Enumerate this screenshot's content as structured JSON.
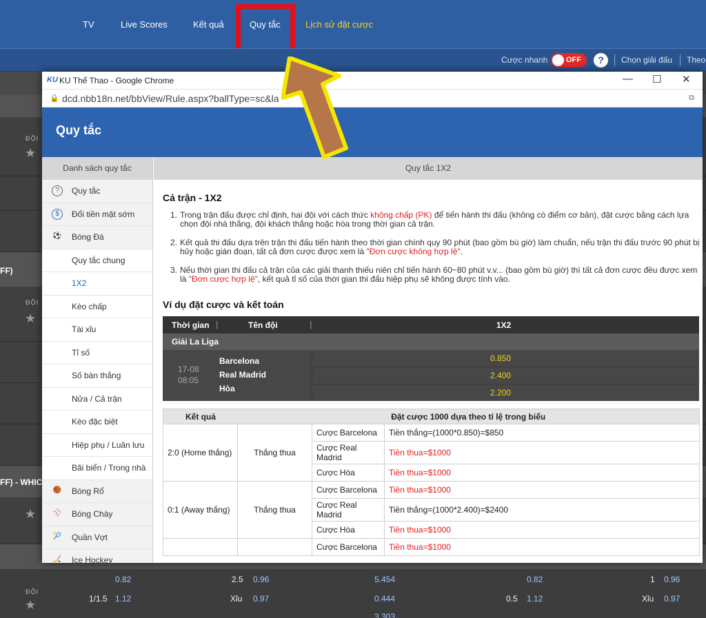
{
  "nav": {
    "tv": "TV",
    "live": "Live Scores",
    "result": "Kết quả",
    "rules": "Quy tắc",
    "history": "Lịch sử đặt cược"
  },
  "subbar": {
    "quick_bet": "Cược nhanh",
    "toggle": "OFF",
    "help": "?",
    "choose_league": "Chọn giải đấu",
    "sort": "Theo"
  },
  "background": {
    "code": "ĐỘI",
    "side_tag_1": "FF)",
    "side_tag_2": "FF) - WHICH"
  },
  "bottom_odds": {
    "r1": [
      "0.82",
      "2.5",
      "0.96",
      "5.454",
      "0.82",
      "1",
      "0.96"
    ],
    "r2": [
      "1/1.5",
      "1.12",
      "Xỉu",
      "0.97",
      "0.444",
      "0.5",
      "1.12",
      "Xỉu",
      "0.97"
    ],
    "r3": "3.303"
  },
  "window": {
    "favicon": "KU",
    "title": "KU Thể Thao - Google Chrome",
    "minimize": "—",
    "maximize": "☐",
    "close": "✕",
    "url": "dcd.nbb18n.net/bbView/Rule.aspx?ballType=sc&la"
  },
  "rules": {
    "heading": "Quy tắc",
    "list_title": "Danh sách quy tắc",
    "content_title": "Quy tắc 1X2",
    "nav": [
      {
        "label": "Quy tắc",
        "icon": "?"
      },
      {
        "label": "Đổi tiền mặt sớm",
        "icon": "$"
      },
      {
        "label": "Bóng Đá",
        "icon": "⚽"
      },
      {
        "label": "Quy tắc chung"
      },
      {
        "label": "1X2"
      },
      {
        "label": "Kèo chấp"
      },
      {
        "label": "Tài xỉu"
      },
      {
        "label": "Tỉ số"
      },
      {
        "label": "Số bàn thắng"
      },
      {
        "label": "Nửa / Cả trận"
      },
      {
        "label": "Kèo đặc biệt"
      },
      {
        "label": "Hiệp phụ / Luân lưu"
      },
      {
        "label": "Bãi biển / Trong nhà"
      },
      {
        "label": "Bóng Rổ",
        "icon": "🏀"
      },
      {
        "label": "Bóng Chày",
        "icon": "⚾"
      },
      {
        "label": "Quần Vợt",
        "icon": "🎾"
      },
      {
        "label": "Ice Hockey",
        "icon": "🏒"
      }
    ],
    "section": "Cả trận - 1X2",
    "items": [
      {
        "n": "1.",
        "a": "Trong trận đấu được chỉ định, hai đội với cách thức ",
        "red": "không chấp (PK)",
        "b": " để tiến hành thi đấu (không có điểm cơ bản), đặt cược bằng cách lựa chọn đội nhà thắng, đội khách thắng hoặc hòa trong thời gian cả trận."
      },
      {
        "n": "2.",
        "a": "Kết quả thi đấu dựa trên trận thi đấu tiến hành theo thời gian chính quy 90 phút (bao gồm bù giờ) làm chuẩn, nếu trận thi đấu trước 90 phút bị hủy hoặc gián đoạn, tất cả đơn cược được xem là ",
        "red": "\"Đơn cược không hợp lệ\"",
        "b": "."
      },
      {
        "n": "3.",
        "a": "Nếu thời gian thi đấu cả trận của các giải thanh thiếu niên chỉ tiến hành 60~80 phút v.v... (bao gồm bù giờ) thì tất cả đơn cược đều được xem là ",
        "red": "\"Đơn cược hợp lệ\"",
        "b": ", kết quả tỉ số của thời gian thi đấu hiệp phụ sẽ không được tính vào."
      }
    ],
    "example_title": "Ví dụ đặt cược và kết toán",
    "odds_table": {
      "h_time": "Thời gian",
      "h_team": "Tên đội",
      "h_market": "1X2",
      "league": "Giải La Liga",
      "date": "17-08",
      "time": "08:05",
      "teams": [
        "Barcelona",
        "Real Madrid",
        "Hòa"
      ],
      "odds": [
        "0.850",
        "2.400",
        "2.200"
      ]
    },
    "settle": {
      "h_result": "Kết quả",
      "h_bet": "Đặt cược 1000 dựa theo tỉ lệ trong biểu",
      "win_lose": "Thắng thua",
      "rows": [
        {
          "result": "2:0 (Home thắng)",
          "bets": [
            {
              "bet": "Cược Barcelona",
              "out": "Tiền thắng=(1000*0.850)=$850",
              "red": false
            },
            {
              "bet": "Cược Real Madrid",
              "out": "Tiền thua=$1000",
              "red": true
            },
            {
              "bet": "Cược Hòa",
              "out": "Tiền thua=$1000",
              "red": true
            }
          ]
        },
        {
          "result": "0:1 (Away thắng)",
          "bets": [
            {
              "bet": "Cược Barcelona",
              "out": "Tiền thua=$1000",
              "red": true
            },
            {
              "bet": "Cược Real Madrid",
              "out": "Tiền thắng=(1000*2.400)=$2400",
              "red": false
            },
            {
              "bet": "Cược Hòa",
              "out": "Tiền thua=$1000",
              "red": true
            }
          ]
        },
        {
          "result": "",
          "bets": [
            {
              "bet": "Cược Barcelona",
              "out": "Tiền thua=$1000",
              "red": true
            }
          ]
        }
      ]
    }
  },
  "colors": {
    "nav_bg": "#2f5fa3",
    "highlight": "#e0111b",
    "history_link": "#f4d21c",
    "odds_yellow": "#f4d21c",
    "loss_red": "#e01e1e",
    "arrow_fill": "#b7764a",
    "arrow_outline": "#f5e600"
  }
}
